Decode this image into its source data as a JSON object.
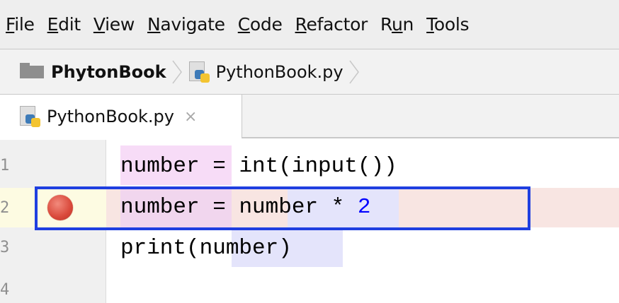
{
  "menubar": {
    "items": [
      {
        "mnemonic": "F",
        "rest": "ile"
      },
      {
        "mnemonic": "E",
        "rest": "dit"
      },
      {
        "mnemonic": "V",
        "rest": "iew"
      },
      {
        "mnemonic": "N",
        "rest": "avigate"
      },
      {
        "mnemonic": "C",
        "rest": "ode"
      },
      {
        "mnemonic": "R",
        "rest": "efactor"
      },
      {
        "pre": "R",
        "mnemonic": "u",
        "rest": "n"
      },
      {
        "mnemonic": "T",
        "rest": "ools"
      }
    ]
  },
  "navbar": {
    "folder_icon": "folder-icon",
    "project_name": "PhytonBook",
    "file_icon": "python-file-icon",
    "file_name": "PythonBook.py"
  },
  "tabs": [
    {
      "label": "PythonBook.py",
      "close_glyph": "×",
      "icon": "python-file-icon",
      "active": true
    }
  ],
  "editor": {
    "lines": [
      {
        "number": "1",
        "tokens": [
          {
            "t": "number"
          },
          {
            "t": " = "
          },
          {
            "t": "int(input())"
          }
        ]
      },
      {
        "number": "2",
        "tokens": [
          {
            "t": "number"
          },
          {
            "t": " = "
          },
          {
            "t": "number"
          },
          {
            "t": " * "
          },
          {
            "t": "2",
            "cls": "num-lit"
          }
        ],
        "breakpoint": true,
        "highlighted": true
      },
      {
        "number": "3",
        "tokens": [
          {
            "t": "print("
          },
          {
            "t": "number"
          },
          {
            "t": ")"
          }
        ]
      },
      {
        "number": "4",
        "tokens": []
      }
    ],
    "colors": {
      "breakpoint": "#d9483a",
      "callout_border": "#1f3fe0",
      "number_literal": "#0000ff",
      "breakpoint_line_bg": "#f8e5e2",
      "occurrence_write": "#f7dcf7",
      "occurrence_read": "#e4e4fb"
    }
  }
}
